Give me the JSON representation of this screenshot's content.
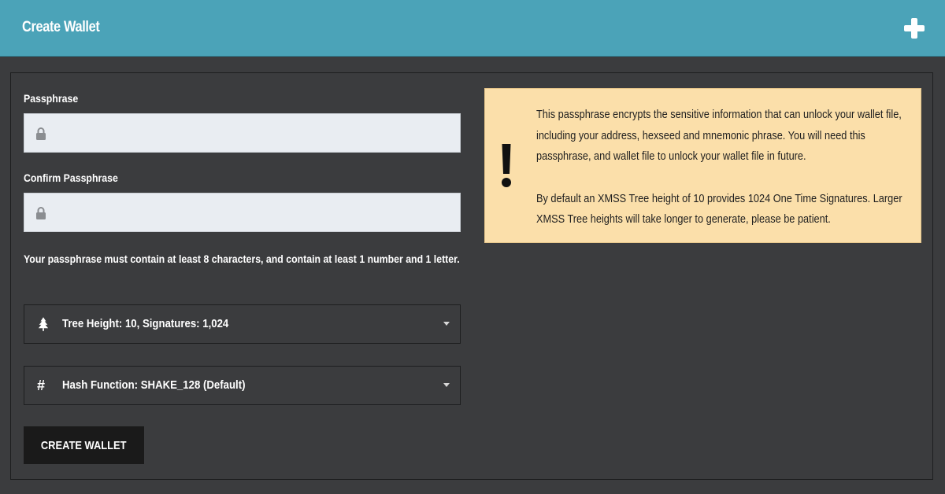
{
  "header": {
    "title": "Create Wallet",
    "add_icon": "plus-icon"
  },
  "form": {
    "passphrase_label": "Passphrase",
    "passphrase_value": "",
    "confirm_label": "Confirm Passphrase",
    "confirm_value": "",
    "lock_icon": "lock-icon",
    "hint": "Your passphrase must contain at least 8 characters, and contain at least 1 number and 1 letter.",
    "tree_height": {
      "icon": "tree-icon",
      "selected": "Tree Height: 10, Signatures: 1,024"
    },
    "hash_function": {
      "icon": "hash-icon",
      "selected": "Hash Function: SHAKE_128 (Default)"
    },
    "submit_label": "CREATE WALLET"
  },
  "info": {
    "icon": "exclamation-icon",
    "paragraph1": "This passphrase encrypts the sensitive information that can unlock your wallet file, including your address, hexseed and mnemonic phrase. You will need this passphrase, and wallet file to unlock your wallet file in future.",
    "paragraph2": "By default an XMSS Tree height of 10 provides 1024 One Time Signatures. Larger XMSS Tree heights will take longer to generate, please be patient."
  },
  "colors": {
    "header_bg": "#4ba3b8",
    "page_bg": "#3b3c3e",
    "info_bg": "#fbdfaa",
    "button_bg": "#1a1a1a",
    "input_bg": "#e9edf2"
  }
}
